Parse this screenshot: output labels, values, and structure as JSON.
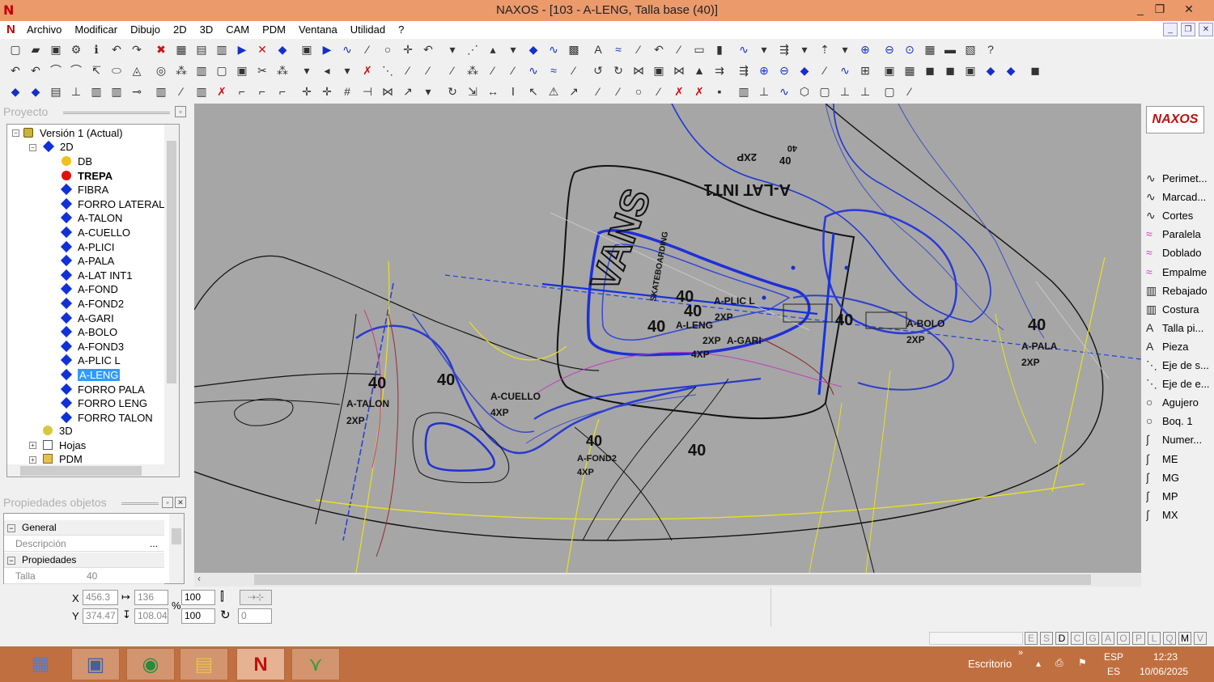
{
  "window": {
    "title": "NAXOS - [103 - A-LENG, Talla base (40)]",
    "logo_letter": "N",
    "controls": [
      "_",
      "❐",
      "✕"
    ],
    "mdi_controls": [
      "_",
      "❐",
      "✕"
    ]
  },
  "menu": {
    "items": [
      "Archivo",
      "Modificar",
      "Dibujo",
      "2D",
      "3D",
      "CAM",
      "PDM",
      "Ventana",
      "Utilidad",
      "?"
    ]
  },
  "project_panel": {
    "title": "Proyecto",
    "tree": {
      "version": "Versión 1 (Actual)",
      "node_2d": "2D",
      "items": [
        {
          "label": "DB",
          "icon": "yellow-dot"
        },
        {
          "label": "TREPA",
          "icon": "red-dot",
          "bold": true
        },
        {
          "label": "FIBRA",
          "icon": "blue-diamond"
        },
        {
          "label": "FORRO LATERAL",
          "icon": "blue-diamond"
        },
        {
          "label": "A-TALON",
          "icon": "blue-diamond"
        },
        {
          "label": "A-CUELLO",
          "icon": "blue-diamond"
        },
        {
          "label": "A-PLICI",
          "icon": "blue-diamond"
        },
        {
          "label": "A-PALA",
          "icon": "blue-diamond"
        },
        {
          "label": "A-LAT INT1",
          "icon": "blue-diamond"
        },
        {
          "label": "A-FOND",
          "icon": "blue-diamond"
        },
        {
          "label": "A-FOND2",
          "icon": "blue-diamond"
        },
        {
          "label": "A-GARI",
          "icon": "blue-diamond"
        },
        {
          "label": "A-BOLO",
          "icon": "blue-diamond"
        },
        {
          "label": "A-FOND3",
          "icon": "blue-diamond"
        },
        {
          "label": "A-PLIC L",
          "icon": "blue-diamond"
        },
        {
          "label": "A-LENG",
          "icon": "blue-diamond",
          "selected": true
        },
        {
          "label": "FORRO PALA",
          "icon": "blue-diamond"
        },
        {
          "label": "FORRO LENG",
          "icon": "blue-diamond"
        },
        {
          "label": "FORRO TALON",
          "icon": "blue-diamond"
        }
      ],
      "node_3d": "3D",
      "node_hojas": "Hojas",
      "node_pdm": "PDM"
    }
  },
  "properties_panel": {
    "title": "Propiedades objetos",
    "section_general": "General",
    "descripcion_label": "Descripción",
    "descripcion_btn": "...",
    "section_propiedades": "Propiedades",
    "talla_label": "Talla",
    "talla_value": "40"
  },
  "right_panel": {
    "logo": "NAXOS",
    "items": [
      {
        "label": "Perimet...",
        "icon": "∿"
      },
      {
        "label": "Marcad...",
        "icon": "∿"
      },
      {
        "label": "Cortes",
        "icon": "∿"
      },
      {
        "label": "Paralela",
        "icon": "≈"
      },
      {
        "label": "Doblado",
        "icon": "≈"
      },
      {
        "label": "Empalme",
        "icon": "≈"
      },
      {
        "label": "Rebajado",
        "icon": "▥"
      },
      {
        "label": "Costura",
        "icon": "▥"
      },
      {
        "label": "Talla pi...",
        "icon": "A"
      },
      {
        "label": "Pieza",
        "icon": "A"
      },
      {
        "label": "Eje de s...",
        "icon": "⋱"
      },
      {
        "label": "Eje de e...",
        "icon": "⋱"
      },
      {
        "label": "Agujero",
        "icon": "○"
      },
      {
        "label": "Boq. 1",
        "icon": "○"
      },
      {
        "label": "Numer...",
        "icon": "∫"
      },
      {
        "label": "ME",
        "icon": "∫"
      },
      {
        "label": "MG",
        "icon": "∫"
      },
      {
        "label": "MP",
        "icon": "∫"
      },
      {
        "label": "MX",
        "icon": "∫"
      }
    ]
  },
  "canvas": {
    "labels": [
      {
        "text": "40"
      },
      {
        "text": "2XP"
      },
      {
        "text": "A-LAT INT1"
      },
      {
        "text": "40"
      },
      {
        "text": "40"
      },
      {
        "text": "A-PLIC L"
      },
      {
        "text": "2XP"
      },
      {
        "text": "40"
      },
      {
        "text": "A-LENG"
      },
      {
        "text": "40"
      },
      {
        "text": "2XP"
      },
      {
        "text": "A-GARI"
      },
      {
        "text": "4XP"
      },
      {
        "text": "40"
      },
      {
        "text": "A-BOLO"
      },
      {
        "text": "2XP"
      },
      {
        "text": "40"
      },
      {
        "text": "A-PALA"
      },
      {
        "text": "2XP"
      },
      {
        "text": "40"
      },
      {
        "text": "A-TALON"
      },
      {
        "text": "2XP"
      },
      {
        "text": "40"
      },
      {
        "text": "A-CUELLO"
      },
      {
        "text": "4XP"
      },
      {
        "text": "40"
      },
      {
        "text": "A-FOND2"
      },
      {
        "text": "4XP"
      },
      {
        "text": "40"
      },
      {
        "text": "VANS"
      },
      {
        "text": "SKATEBOARDING"
      }
    ]
  },
  "coords": {
    "x_label": "X",
    "y_label": "Y",
    "x_value": "456.3",
    "y_value": "374.47",
    "width_value": "136",
    "height_value": "108.04",
    "scale_x": "100",
    "scale_y": "100",
    "percent": "%",
    "rotation": "0"
  },
  "status": {
    "letters": [
      "E",
      "S",
      "D",
      "C",
      "G",
      "A",
      "O",
      "P",
      "L",
      "Q",
      "M",
      "V"
    ],
    "active": [
      "D",
      "M"
    ]
  },
  "taskbar": {
    "desktop_label": "Escritorio",
    "lang1": "ESP",
    "lang2": "ES",
    "time": "12:23",
    "date": "10/06/2025"
  }
}
